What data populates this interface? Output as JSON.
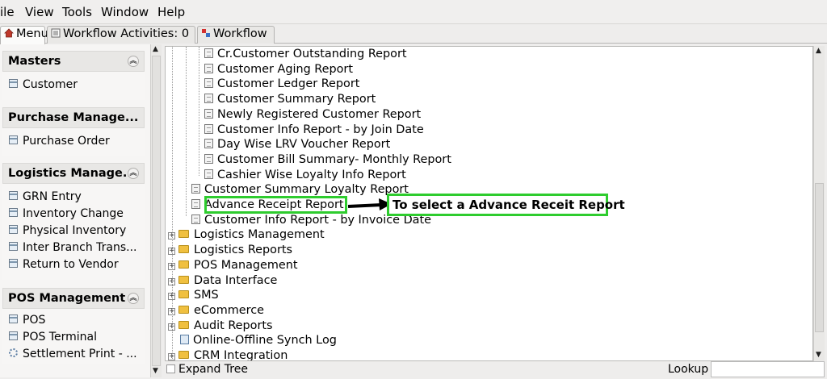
{
  "menu": {
    "file": "ile",
    "view": "View",
    "tools": "Tools",
    "window": "Window",
    "help": "Help"
  },
  "tabs": [
    {
      "label": "Menu",
      "icon": "home-icon"
    },
    {
      "label": "Workflow Activities: 0",
      "icon": "list-icon"
    },
    {
      "label": "Workflow",
      "icon": "workflow-icon"
    }
  ],
  "sidebar": {
    "sections": [
      {
        "title": "Masters",
        "items": [
          {
            "label": "Customer",
            "icon": "doc-icon"
          }
        ]
      },
      {
        "title": "Purchase Manage...",
        "items": [
          {
            "label": "Purchase Order",
            "icon": "doc-icon"
          }
        ]
      },
      {
        "title": "Logistics Manage...",
        "items": [
          {
            "label": "GRN Entry",
            "icon": "doc-icon"
          },
          {
            "label": "Inventory Change",
            "icon": "doc-icon"
          },
          {
            "label": "Physical Inventory",
            "icon": "doc-icon"
          },
          {
            "label": "Inter Branch Trans...",
            "icon": "doc-icon"
          },
          {
            "label": "Return to Vendor",
            "icon": "doc-icon"
          }
        ]
      },
      {
        "title": "POS Management",
        "items": [
          {
            "label": "POS",
            "icon": "doc-icon"
          },
          {
            "label": "POS Terminal",
            "icon": "doc-icon"
          },
          {
            "label": "Settlement Print - ...",
            "icon": "gear-icon"
          }
        ]
      }
    ]
  },
  "tree": {
    "rows": [
      {
        "label": "Cr.Customer Outstanding Report",
        "type": "doc"
      },
      {
        "label": "Customer Aging Report",
        "type": "doc"
      },
      {
        "label": "Customer Ledger Report",
        "type": "doc"
      },
      {
        "label": "Customer Summary Report",
        "type": "doc"
      },
      {
        "label": "Newly Registered Customer Report",
        "type": "doc"
      },
      {
        "label": "Customer Info Report - by Join Date",
        "type": "doc"
      },
      {
        "label": "Day Wise LRV Voucher Report",
        "type": "doc"
      },
      {
        "label": "Customer Bill Summary- Monthly Report",
        "type": "doc"
      },
      {
        "label": "Cashier Wise Loyalty Info Report",
        "type": "doc"
      },
      {
        "label": "Customer Summary Loyalty Report",
        "type": "doc"
      },
      {
        "label": "Advance Receipt Report",
        "type": "doc"
      },
      {
        "label": "Customer Info Report - by Invoice Date",
        "type": "doc"
      },
      {
        "label": "Logistics Management",
        "type": "folder"
      },
      {
        "label": "Logistics Reports",
        "type": "folder"
      },
      {
        "label": "POS Management",
        "type": "folder"
      },
      {
        "label": "Data Interface",
        "type": "folder"
      },
      {
        "label": "SMS",
        "type": "folder"
      },
      {
        "label": "eCommerce",
        "type": "folder"
      },
      {
        "label": "Audit Reports",
        "type": "folder"
      },
      {
        "label": "Online-Offline Synch Log",
        "type": "synch"
      },
      {
        "label": "CRM Integration",
        "type": "folder"
      }
    ]
  },
  "annotation": {
    "callout_text": "To select a Advance Receit Report",
    "highlight_color": "#2ecc2e"
  },
  "bottom": {
    "expand_tree": "Expand Tree",
    "lookup": "Lookup"
  }
}
